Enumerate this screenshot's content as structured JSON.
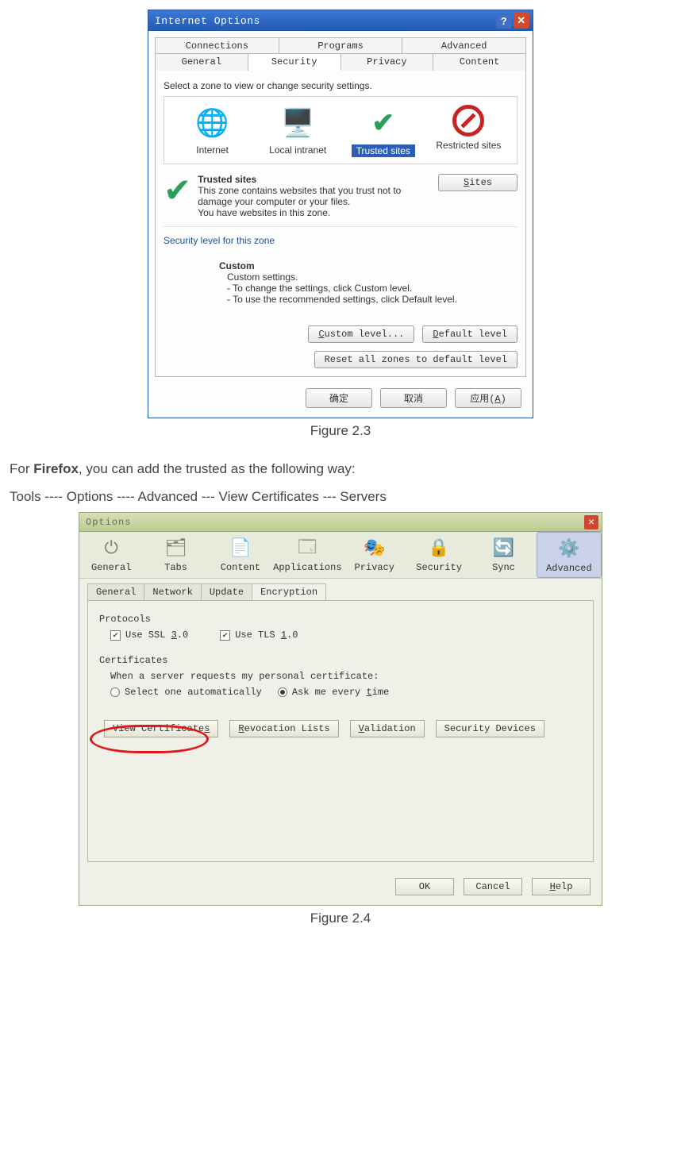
{
  "dlg1": {
    "title": "Internet Options",
    "tabs_top": [
      "Connections",
      "Programs",
      "Advanced"
    ],
    "tabs_bot": {
      "general": "General",
      "security": "Security",
      "privacy": "Privacy",
      "content": "Content"
    },
    "zone_prompt": "Select a zone to view or change security settings.",
    "zones": {
      "internet": "Internet",
      "local": "Local intranet",
      "trusted": "Trusted sites",
      "restricted": "Restricted sites"
    },
    "trusted_block": {
      "heading": "Trusted sites",
      "desc1": "This zone contains websites that you trust not to damage your computer or your files.",
      "desc2": "You have websites in this zone.",
      "sites_btn": "Sites"
    },
    "seclevel": {
      "heading": "Security level for this zone",
      "custom_hd": "Custom",
      "line1": "Custom settings.",
      "line2": "- To change the settings, click Custom level.",
      "line3": "- To use the recommended settings, click Default level."
    },
    "buttons": {
      "custom_level": "Custom level...",
      "default_level": "Default level",
      "reset_all": "Reset all zones to default level",
      "ok": "确定",
      "cancel": "取消",
      "apply": "应用(A)"
    }
  },
  "caption1": "Figure 2.3",
  "para": {
    "pre": "For ",
    "firefox": "Firefox",
    "post": ", you can add the trusted as the following way:",
    "path": "Tools ---- Options ---- Advanced --- View Certificates --- Servers"
  },
  "dlg2": {
    "title": "Options",
    "toolbar": [
      "General",
      "Tabs",
      "Content",
      "Applications",
      "Privacy",
      "Security",
      "Sync",
      "Advanced"
    ],
    "subtabs": {
      "general": "General",
      "network": "Network",
      "update": "Update",
      "encryption": "Encryption"
    },
    "protocols": {
      "heading": "Protocols",
      "ssl": "Use SSL 3.0",
      "tls": "Use TLS 1.0"
    },
    "certificates": {
      "heading": "Certificates",
      "prompt": "When a server requests my personal certificate:",
      "auto": "Select one automatically",
      "ask": "Ask me every time",
      "btn_view": "View Certificates",
      "btn_rev": "Revocation Lists",
      "btn_val": "Validation",
      "btn_dev": "Security Devices"
    },
    "footer": {
      "ok": "OK",
      "cancel": "Cancel",
      "help": "Help"
    }
  },
  "caption2": "Figure 2.4"
}
